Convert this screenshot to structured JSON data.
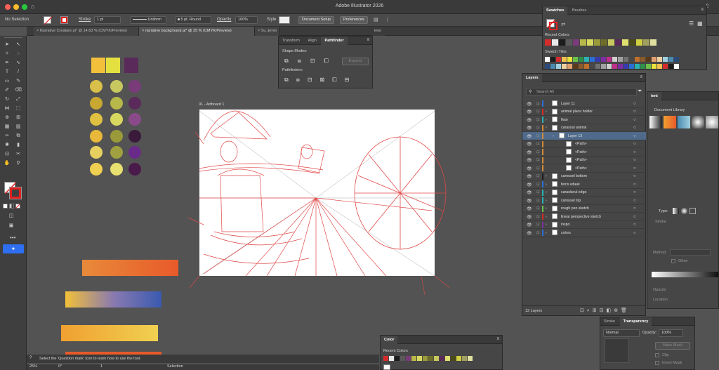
{
  "window": {
    "title": "Adobe Illustrator 2026"
  },
  "control_bar": {
    "selection": "No Selection",
    "stroke_label": "Stroke",
    "stroke_value": "1 pt",
    "profile": "Uniform",
    "brush": "5 pt. Round",
    "opacity_label": "Opacity",
    "opacity_value": "100%",
    "style_label": "Style",
    "doc_setup": "Document Setup",
    "preferences": "Preferences"
  },
  "doc_tabs": [
    "Narrative Creature.ai* @ 14.63 % (CMYK/Preview)",
    "narrative background.ai* @ 25 % (CMYK/Preview)",
    "Su_Emm",
    "iew)"
  ],
  "artboard": {
    "label": "01 - Artboard 1"
  },
  "pathfinder": {
    "tabs": [
      "Transform",
      "Align",
      "Pathfinder"
    ],
    "shape_modes": "Shape Modes:",
    "expand": "Expand",
    "pathfinders": "Pathfinders:"
  },
  "swatches": {
    "tabs": [
      "Swatches",
      "Brushes"
    ],
    "recent_colors": "Recent Colors",
    "swatch_tiles": "Swatch Tiles",
    "recent": [
      "#d62b2b",
      "#e8e8e8",
      "#1c1c1c",
      "#5a5a5a",
      "#7a3b7a",
      "#b8b84a",
      "#d8d860",
      "#9a9a3a",
      "#6e6e2a",
      "#c8c860",
      "#5a2a5a",
      "#e0e070",
      "#4a4a1a",
      "#d0d040",
      "#a0a060",
      "#e0e0a0"
    ],
    "tiles": [
      "#ffffff",
      "#1c1c1c",
      "#d62b2b",
      "#f2c14e",
      "#e8e23a",
      "#6cc04a",
      "#2f8f4a",
      "#2ab3b3",
      "#2a6fd6",
      "#3a3ab0",
      "#7a2fa0",
      "#c02f8a",
      "#d0d0d0",
      "#a0a0a0",
      "#707070",
      "#484848",
      "#c0702a",
      "#8a5a2a",
      "#5a3a1a",
      "#e0a070",
      "#f0d0a0",
      "#a0d0e0",
      "#4a8ab0",
      "#2a4a7a"
    ]
  },
  "layers": {
    "title": "Layers",
    "search_placeholder": "Search All",
    "count": "12 Layers",
    "rows": [
      {
        "name": "Layer 11",
        "color": "#2a6fd6",
        "indent": 0,
        "expand": false,
        "sel": false
      },
      {
        "name": "animal place holder",
        "color": "#d62b2b",
        "indent": 0,
        "expand": true,
        "sel": false
      },
      {
        "name": "floor",
        "color": "#2ab3b3",
        "indent": 0,
        "expand": true,
        "sel": false
      },
      {
        "name": "carasoul animal",
        "color": "#d08a3a",
        "indent": 0,
        "expand": true,
        "sel": false
      },
      {
        "name": "Layer 13",
        "color": "#d08a3a",
        "indent": 1,
        "expand": true,
        "sel": true
      },
      {
        "name": "<Path>",
        "color": "#d08a3a",
        "indent": 2,
        "expand": false,
        "sel": false
      },
      {
        "name": "<Path>",
        "color": "#d08a3a",
        "indent": 2,
        "expand": false,
        "sel": false
      },
      {
        "name": "<Path>",
        "color": "#d08a3a",
        "indent": 2,
        "expand": false,
        "sel": false
      },
      {
        "name": "<Path>",
        "color": "#d08a3a",
        "indent": 2,
        "expand": false,
        "sel": false
      },
      {
        "name": "carousel bottom",
        "color": "#1c1c1c",
        "indent": 0,
        "expand": true,
        "sel": false
      },
      {
        "name": "ferris wheel",
        "color": "#2a6fd6",
        "indent": 0,
        "expand": true,
        "sel": false
      },
      {
        "name": "caraslsoul edge",
        "color": "#2ab3b3",
        "indent": 0,
        "expand": true,
        "sel": false
      },
      {
        "name": "carousel top",
        "color": "#2ab3b3",
        "indent": 0,
        "expand": true,
        "sel": false
      },
      {
        "name": "rough pen sketch",
        "color": "#6cc04a",
        "indent": 0,
        "expand": true,
        "sel": false
      },
      {
        "name": "linear perspective sketch",
        "color": "#d62b2b",
        "indent": 0,
        "expand": true,
        "sel": false
      },
      {
        "name": "inspo",
        "color": "#7a2fa0",
        "indent": 0,
        "expand": true,
        "sel": false
      },
      {
        "name": "colors",
        "color": "#2a6fd6",
        "indent": 0,
        "expand": true,
        "sel": false
      }
    ]
  },
  "gradient_panel": {
    "tab": "ient",
    "doc_library": "Document Library",
    "type": "Type:",
    "stroke": "Stroke",
    "method": "Method",
    "other": "Other",
    "opacity": "Opacity",
    "location": "Location"
  },
  "transparency": {
    "tabs": [
      "Stroke",
      "Transparency"
    ],
    "mode": "Normal",
    "opacity_label": "Opacity:",
    "opacity_value": "100%",
    "make_mask": "Make Mask",
    "clip": "Clip",
    "invert": "Invert Mask"
  },
  "color_panel": {
    "tab": "Color",
    "recent_colors": "Recent Colors"
  },
  "status": {
    "hint": "Select the 'Question mark' icon to learn how to use the tool.",
    "zoom": "25%",
    "rotation": "0°",
    "page": "1",
    "tool": "Selection"
  },
  "palette": {
    "squares": [
      "#f2c03a",
      "#e4e040",
      "#5a2a5a"
    ],
    "dots": [
      [
        "#d8c04a",
        "#c8c860",
        "#7a3b7a"
      ],
      [
        "#c8a830",
        "#b8b84a",
        "#5a2a5a"
      ],
      [
        "#e0c040",
        "#d8d860",
        "#8a4a8a"
      ],
      [
        "#e8b83a",
        "#9a9a3a",
        "#3a1a3a"
      ],
      [
        "#e8d060",
        "#a0a040",
        "#6a2a8a"
      ],
      [
        "#f0d050",
        "#e8e070",
        "#4a1a4a"
      ]
    ],
    "bars": [
      "#e87a2a",
      "#f2c03a",
      "#f0a030",
      "#e87a2a"
    ]
  }
}
